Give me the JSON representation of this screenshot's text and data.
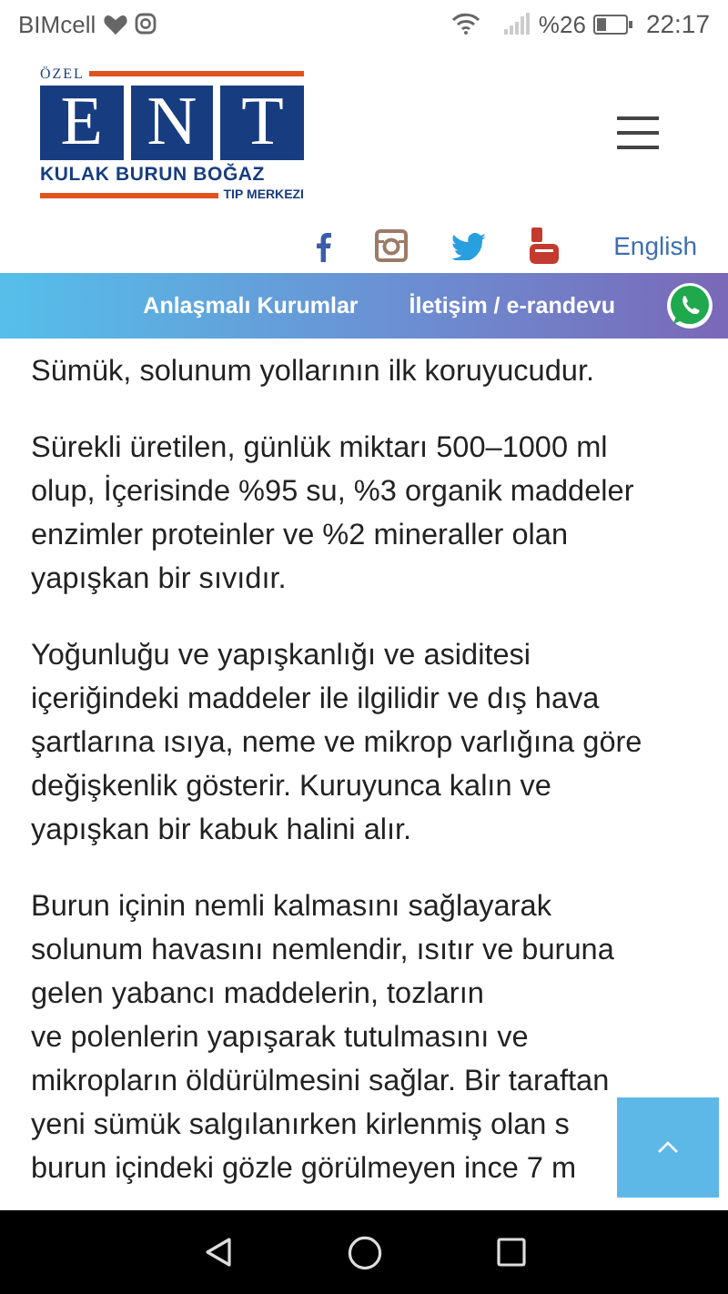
{
  "status_bar": {
    "carrier": "BIMcell",
    "battery": "%26",
    "time": "22:17"
  },
  "logo": {
    "top": "ÖZEL",
    "letters": [
      "E",
      "N",
      "T"
    ],
    "subtitle": "KULAK BURUN BOĞAZ",
    "bottom": "TIP MERKEZI"
  },
  "language_link": "English",
  "nav": [
    {
      "label": "Anlaşmalı Kurumlar"
    },
    {
      "label": "İletişim / e-randevu"
    }
  ],
  "paragraphs": [
    {
      "lines": [
        "Sümük, solunum yollarının ilk koruyucudur."
      ]
    },
    {
      "lines": [
        "Sürekli üretilen, günlük miktarı 500–1000 ml",
        "olup, İçerisinde %95 su, %3 organik maddeler",
        "enzimler proteinler ve %2 mineraller olan",
        "yapışkan bir sıvıdır."
      ]
    },
    {
      "lines": [
        "Yoğunluğu ve yapışkanlığı ve asiditesi",
        "içeriğindeki maddeler ile ilgilidir ve dış hava",
        "şartlarına ısıya, neme ve mikrop varlığına göre",
        "değişkenlik gösterir. Kuruyunca kalın ve",
        "yapışkan bir kabuk halini alır."
      ]
    },
    {
      "lines": [
        "Burun içinin nemli kalmasını sağlayarak",
        "solunum havasını nemlendir, ısıtır ve buruna",
        "gelen yabancı maddelerin, tozların",
        "ve polenlerin yapışarak tutulmasını ve",
        "mikropların öldürülmesini sağlar. Bir taraftan",
        "yeni sümük salgılanırken kirlenmiş olan s",
        "burun içindeki gözle görülmeyen ince 7 m"
      ]
    }
  ]
}
